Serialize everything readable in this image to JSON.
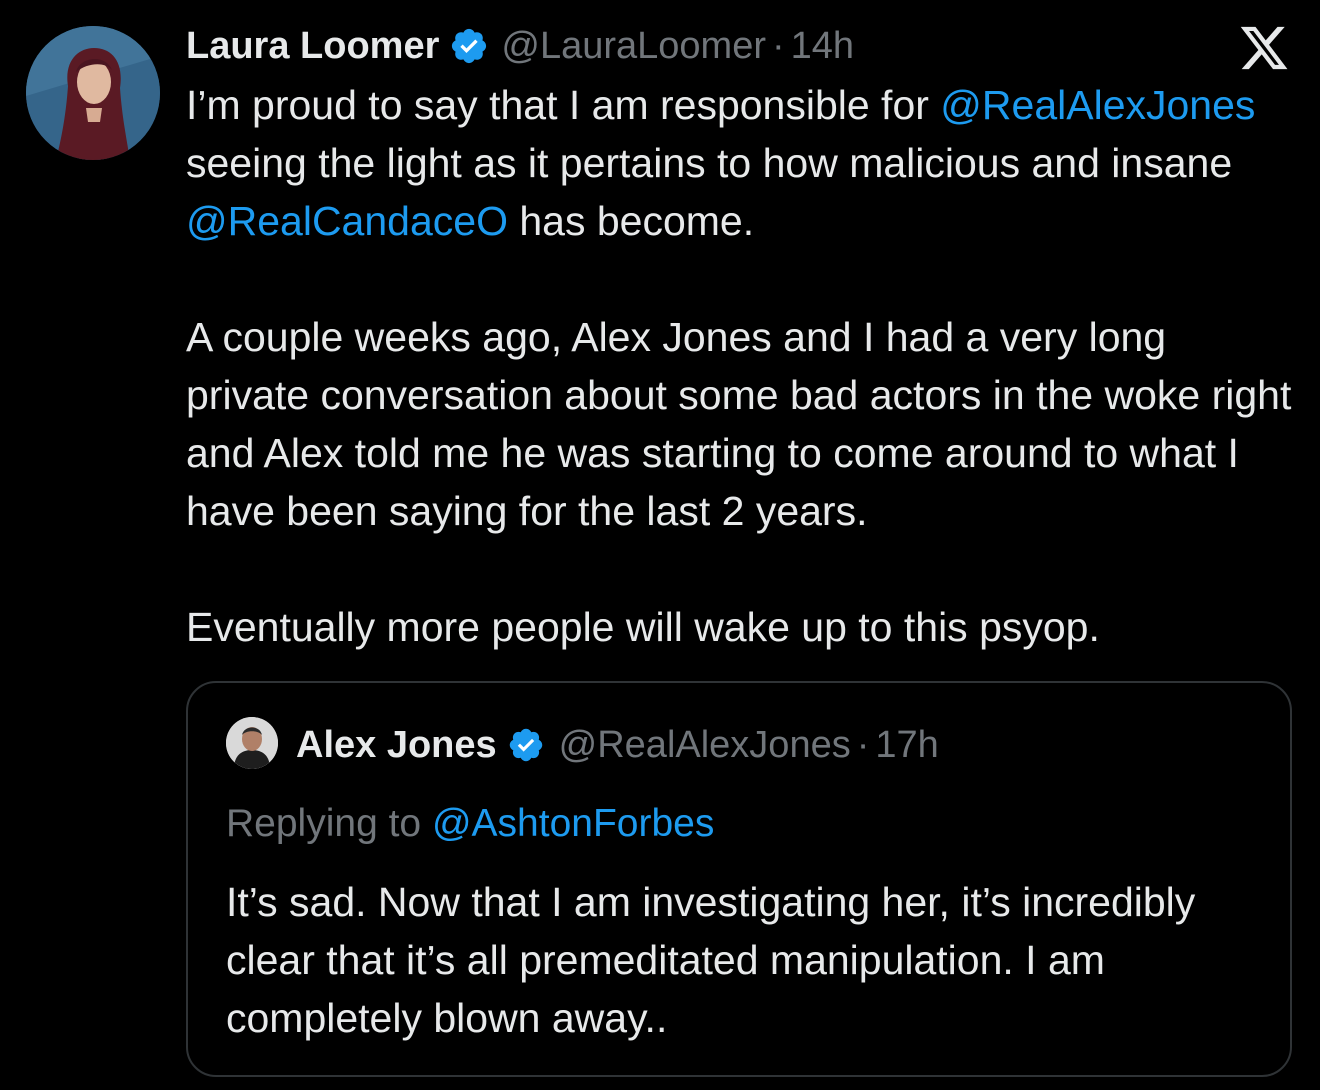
{
  "tweet": {
    "author_name": "Laura Loomer",
    "author_handle": "@LauraLoomer",
    "separator": "·",
    "time": "14h",
    "paragraph1": {
      "part1": "I’m proud to say that I am responsible for ",
      "mention1": "@RealAlexJones",
      "part2": " seeing the light as it pertains to how malicious and insane ",
      "mention2": "@RealCandaceO",
      "part3": " has become."
    },
    "paragraph2": "A couple weeks ago, Alex Jones and I had a very long private conversation about some bad actors in the woke right and Alex told me he was starting to come around to what I have been saying for the last 2 years.",
    "paragraph3": "Eventually more people will wake up to this psyop."
  },
  "quoted_tweet": {
    "author_name": "Alex Jones",
    "author_handle": "@RealAlexJones",
    "separator": "·",
    "time": "17h",
    "replying_prefix": "Replying to ",
    "replying_to": "@AshtonForbes",
    "text": "It’s sad. Now that I am investigating her, it’s incredibly clear that it’s all premeditated manipulation. I am completely blown away.."
  },
  "icons": {
    "verified": "verified-badge-icon",
    "platform": "x-logo-icon"
  },
  "colors": {
    "background": "#000000",
    "text": "#e7e9ea",
    "muted": "#71767b",
    "link": "#1d9bf0",
    "border": "#2f3336"
  }
}
